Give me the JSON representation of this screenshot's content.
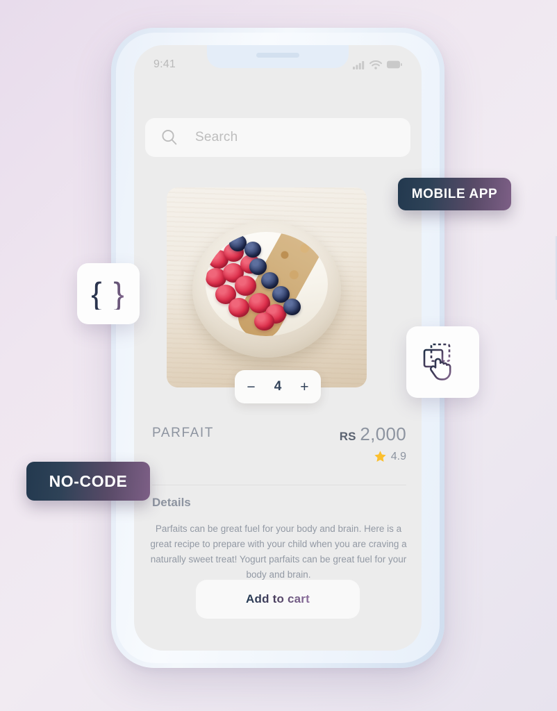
{
  "background": {
    "gradient_from": "#e8dcec",
    "gradient_to": "#e7e3ee"
  },
  "phone": {
    "frame_color": "#dbe6f3",
    "screen_background": "#ececec",
    "status_bar": {
      "time": "9:41",
      "icons": [
        "signal-icon",
        "wifi-icon",
        "battery-icon"
      ]
    }
  },
  "app": {
    "search": {
      "placeholder": "Search",
      "icon": "search-icon"
    },
    "product": {
      "image_alt": "yogurt-parfait-bowl",
      "title": "PARFAIT",
      "price_currency": "RS",
      "price_amount": "2,000",
      "rating_icon": "star-icon",
      "rating_value": "4.9",
      "star_color": "#fbbf2e",
      "quantity": {
        "decrement_label": "−",
        "value": "4",
        "increment_label": "+"
      },
      "details_heading": "Details",
      "details_text": "Parfaits can be great fuel for your body and brain. Here is a great recipe to prepare with your child when you are craving a naturally sweet treat! Yogurt parfaits can be great fuel for your body and brain.",
      "add_to_cart_label": "Add to cart"
    }
  },
  "annotations": {
    "badges": [
      {
        "id": "mobile-app",
        "label": "MOBILE APP"
      },
      {
        "id": "no-code",
        "label": "NO-CODE"
      }
    ],
    "icon_cards": [
      {
        "id": "code-braces",
        "glyph": "{ }",
        "name": "code-braces-icon"
      },
      {
        "id": "drag-drop",
        "name": "drag-drop-icon"
      }
    ],
    "badge_gradient_from": "#23394f",
    "badge_gradient_to": "#7d5f86"
  }
}
